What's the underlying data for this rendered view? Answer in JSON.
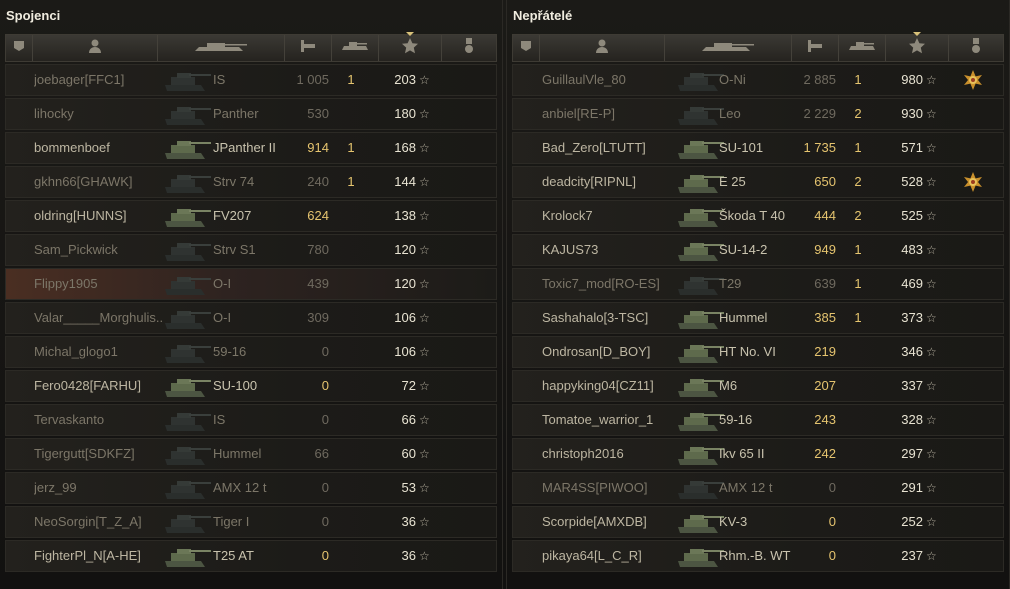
{
  "allies": {
    "title": "Spojenci",
    "rows": [
      {
        "name": "joebager[FFC1]",
        "vehicle": "IS",
        "damage": "1 005",
        "kills": "1",
        "xp": "203",
        "dead": true,
        "highlight": false,
        "medal": false
      },
      {
        "name": "lihocky",
        "vehicle": "Panther",
        "damage": "530",
        "kills": "",
        "xp": "180",
        "dead": true,
        "highlight": false,
        "medal": false
      },
      {
        "name": "bommenboef",
        "vehicle": "JPanther II",
        "damage": "914",
        "kills": "1",
        "xp": "168",
        "dead": false,
        "highlight": false,
        "medal": false
      },
      {
        "name": "gkhn66[GHAWK]",
        "vehicle": "Strv 74",
        "damage": "240",
        "kills": "1",
        "xp": "144",
        "dead": true,
        "highlight": false,
        "medal": false
      },
      {
        "name": "oldring[HUNNS]",
        "vehicle": "FV207",
        "damage": "624",
        "kills": "",
        "xp": "138",
        "dead": false,
        "highlight": false,
        "medal": false
      },
      {
        "name": "Sam_Pickwick",
        "vehicle": "Strv S1",
        "damage": "780",
        "kills": "",
        "xp": "120",
        "dead": true,
        "highlight": false,
        "medal": false
      },
      {
        "name": "Flippy1905",
        "vehicle": "O-I",
        "damage": "439",
        "kills": "",
        "xp": "120",
        "dead": true,
        "highlight": true,
        "medal": false
      },
      {
        "name": "Valar_____Morghulis..",
        "vehicle": "O-I",
        "damage": "309",
        "kills": "",
        "xp": "106",
        "dead": true,
        "highlight": false,
        "medal": false
      },
      {
        "name": "Michal_glogo1",
        "vehicle": "59-16",
        "damage": "0",
        "kills": "",
        "xp": "106",
        "dead": true,
        "highlight": false,
        "medal": false
      },
      {
        "name": "Fero0428[FARHU]",
        "vehicle": "SU-100",
        "damage": "0",
        "kills": "",
        "xp": "72",
        "dead": false,
        "highlight": false,
        "medal": false
      },
      {
        "name": "Tervaskanto",
        "vehicle": "IS",
        "damage": "0",
        "kills": "",
        "xp": "66",
        "dead": true,
        "highlight": false,
        "medal": false
      },
      {
        "name": "Tigergutt[SDKFZ]",
        "vehicle": "Hummel",
        "damage": "66",
        "kills": "",
        "xp": "60",
        "dead": true,
        "highlight": false,
        "medal": false
      },
      {
        "name": "jerz_99",
        "vehicle": "AMX 12 t",
        "damage": "0",
        "kills": "",
        "xp": "53",
        "dead": true,
        "highlight": false,
        "medal": false
      },
      {
        "name": "NeoSorgin[T_Z_A]",
        "vehicle": "Tiger I",
        "damage": "0",
        "kills": "",
        "xp": "36",
        "dead": true,
        "highlight": false,
        "medal": false
      },
      {
        "name": "FighterPl_N[A-HE]",
        "vehicle": "T25 AT",
        "damage": "0",
        "kills": "",
        "xp": "36",
        "dead": false,
        "highlight": false,
        "medal": false
      }
    ]
  },
  "enemies": {
    "title": "Nepřátelé",
    "rows": [
      {
        "name": "GuillaulVle_80",
        "vehicle": "O-Ni",
        "damage": "2 885",
        "kills": "1",
        "xp": "980",
        "dead": true,
        "highlight": false,
        "medal": true
      },
      {
        "name": "anbiel[RE-P]",
        "vehicle": "Leo",
        "damage": "2 229",
        "kills": "2",
        "xp": "930",
        "dead": true,
        "highlight": false,
        "medal": false
      },
      {
        "name": "Bad_Zero[LTUTT]",
        "vehicle": "SU-101",
        "damage": "1 735",
        "kills": "1",
        "xp": "571",
        "dead": false,
        "highlight": false,
        "medal": false
      },
      {
        "name": "deadcity[RIPNL]",
        "vehicle": "E 25",
        "damage": "650",
        "kills": "2",
        "xp": "528",
        "dead": false,
        "highlight": false,
        "medal": true
      },
      {
        "name": "Krolock7",
        "vehicle": "Škoda T 40",
        "damage": "444",
        "kills": "2",
        "xp": "525",
        "dead": false,
        "highlight": false,
        "medal": false
      },
      {
        "name": "KAJUS73",
        "vehicle": "SU-14-2",
        "damage": "949",
        "kills": "1",
        "xp": "483",
        "dead": false,
        "highlight": false,
        "medal": false
      },
      {
        "name": "Toxic7_mod[RO-ES]",
        "vehicle": "T29",
        "damage": "639",
        "kills": "1",
        "xp": "469",
        "dead": true,
        "highlight": false,
        "medal": false
      },
      {
        "name": "Sashahalo[3-TSC]",
        "vehicle": "Hummel",
        "damage": "385",
        "kills": "1",
        "xp": "373",
        "dead": false,
        "highlight": false,
        "medal": false
      },
      {
        "name": "Ondrosan[D_BOY]",
        "vehicle": "HT No. VI",
        "damage": "219",
        "kills": "",
        "xp": "346",
        "dead": false,
        "highlight": false,
        "medal": false
      },
      {
        "name": "happyking04[CZ11]",
        "vehicle": "M6",
        "damage": "207",
        "kills": "",
        "xp": "337",
        "dead": false,
        "highlight": false,
        "medal": false
      },
      {
        "name": "Tomatoe_warrior_1",
        "vehicle": "59-16",
        "damage": "243",
        "kills": "",
        "xp": "328",
        "dead": false,
        "highlight": false,
        "medal": false
      },
      {
        "name": "christoph2016",
        "vehicle": "Ikv 65 II",
        "damage": "242",
        "kills": "",
        "xp": "297",
        "dead": false,
        "highlight": false,
        "medal": false
      },
      {
        "name": "MAR4SS[PIWOO]",
        "vehicle": "AMX 12 t",
        "damage": "0",
        "kills": "",
        "xp": "291",
        "dead": true,
        "highlight": false,
        "medal": false
      },
      {
        "name": "Scorpide[AMXDB]",
        "vehicle": "KV-3",
        "damage": "0",
        "kills": "",
        "xp": "252",
        "dead": false,
        "highlight": false,
        "medal": false
      },
      {
        "name": "pikaya64[L_C_R]",
        "vehicle": "Rhm.-B. WT",
        "damage": "0",
        "kills": "",
        "xp": "237",
        "dead": false,
        "highlight": false,
        "medal": false
      }
    ]
  },
  "icons": {
    "col_squad": "squad-icon",
    "col_player": "player-icon",
    "col_vehicle": "tank-icon",
    "col_damage": "damage-icon",
    "col_kills": "kills-icon",
    "col_xp": "star-icon",
    "col_medal": "medal-icon",
    "star_glyph": "☆"
  },
  "colors": {
    "accent_gold": "#e5c46f",
    "title": "#f0ecdf",
    "dead_text": "#7c7668"
  }
}
